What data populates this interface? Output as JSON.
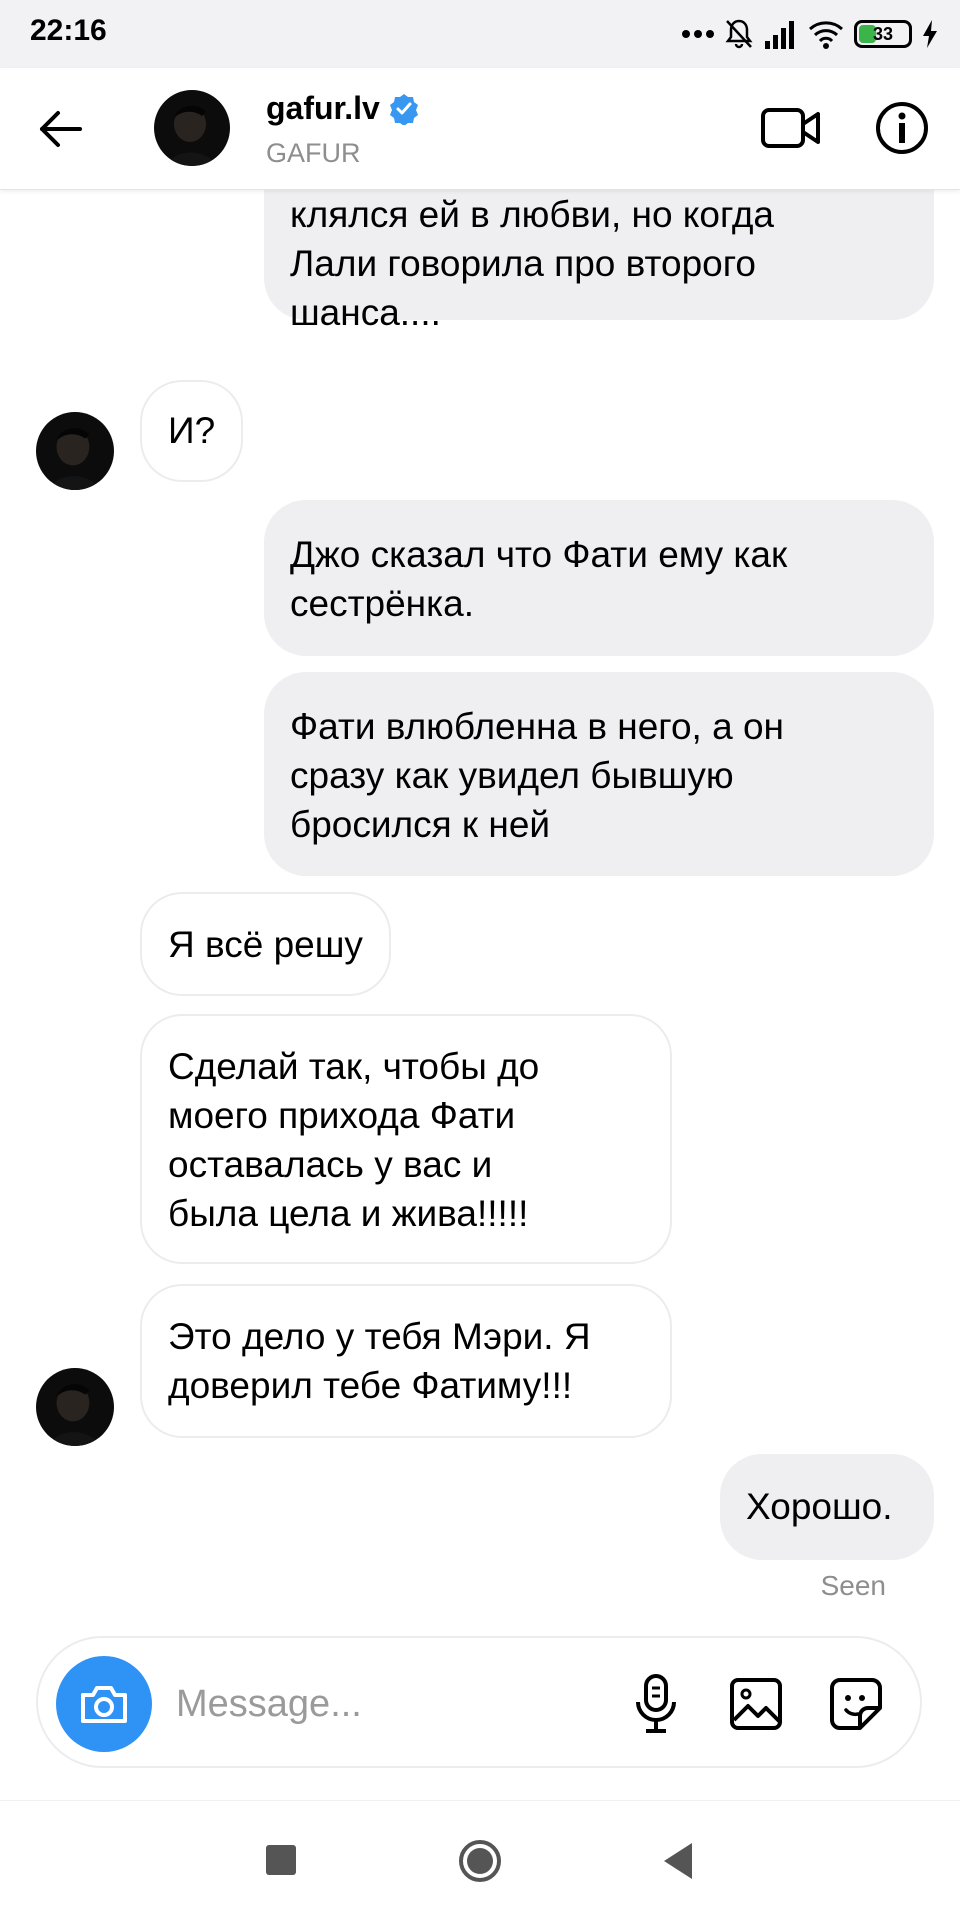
{
  "status_bar": {
    "time": "22:16",
    "battery": "33",
    "icons": [
      "dots-icon",
      "bell-off-icon",
      "signal-icon",
      "wifi-icon",
      "battery-icon",
      "charging-icon"
    ]
  },
  "header": {
    "username": "gafur.lv",
    "subtitle": "GAFUR",
    "verified": true,
    "icons": [
      "back-arrow-icon",
      "video-call-icon",
      "info-icon",
      "verified-badge-icon"
    ]
  },
  "messages": [
    {
      "direction": "out",
      "text": "клялся ей в любви, но когда\nЛали говорила про второго\nшанса...."
    },
    {
      "direction": "in",
      "text": "И?",
      "avatar": true
    },
    {
      "direction": "out",
      "text": "Джо сказал что Фати ему как\nсестрёнка."
    },
    {
      "direction": "out",
      "text": "Фати влюбленна в него, а он\nсразу как увидел бывшую\nбросился к ней"
    },
    {
      "direction": "in",
      "text": "Я всё решу"
    },
    {
      "direction": "in",
      "text": "Сделай так, чтобы до\nмоего прихода Фати\nоставалась у вас и\nбыла цела и жива!!!!!"
    },
    {
      "direction": "in",
      "text": "Это дело у тебя Мэри. Я\nдоверил тебе Фатиму!!!",
      "avatar": true
    },
    {
      "direction": "out",
      "text": "Хорошо."
    }
  ],
  "seen_label": "Seen",
  "composer": {
    "placeholder": "Message...",
    "icons": [
      "camera-icon",
      "microphone-icon",
      "gallery-icon",
      "sticker-icon"
    ]
  },
  "navbar": {
    "icons": [
      "recents-icon",
      "home-icon",
      "back-icon"
    ]
  },
  "colors": {
    "accent": "#2f93f5",
    "outgoing_bubble": "#efeff1",
    "incoming_border": "#ececee",
    "verified": "#3897f0",
    "battery": "#3bb54a"
  }
}
